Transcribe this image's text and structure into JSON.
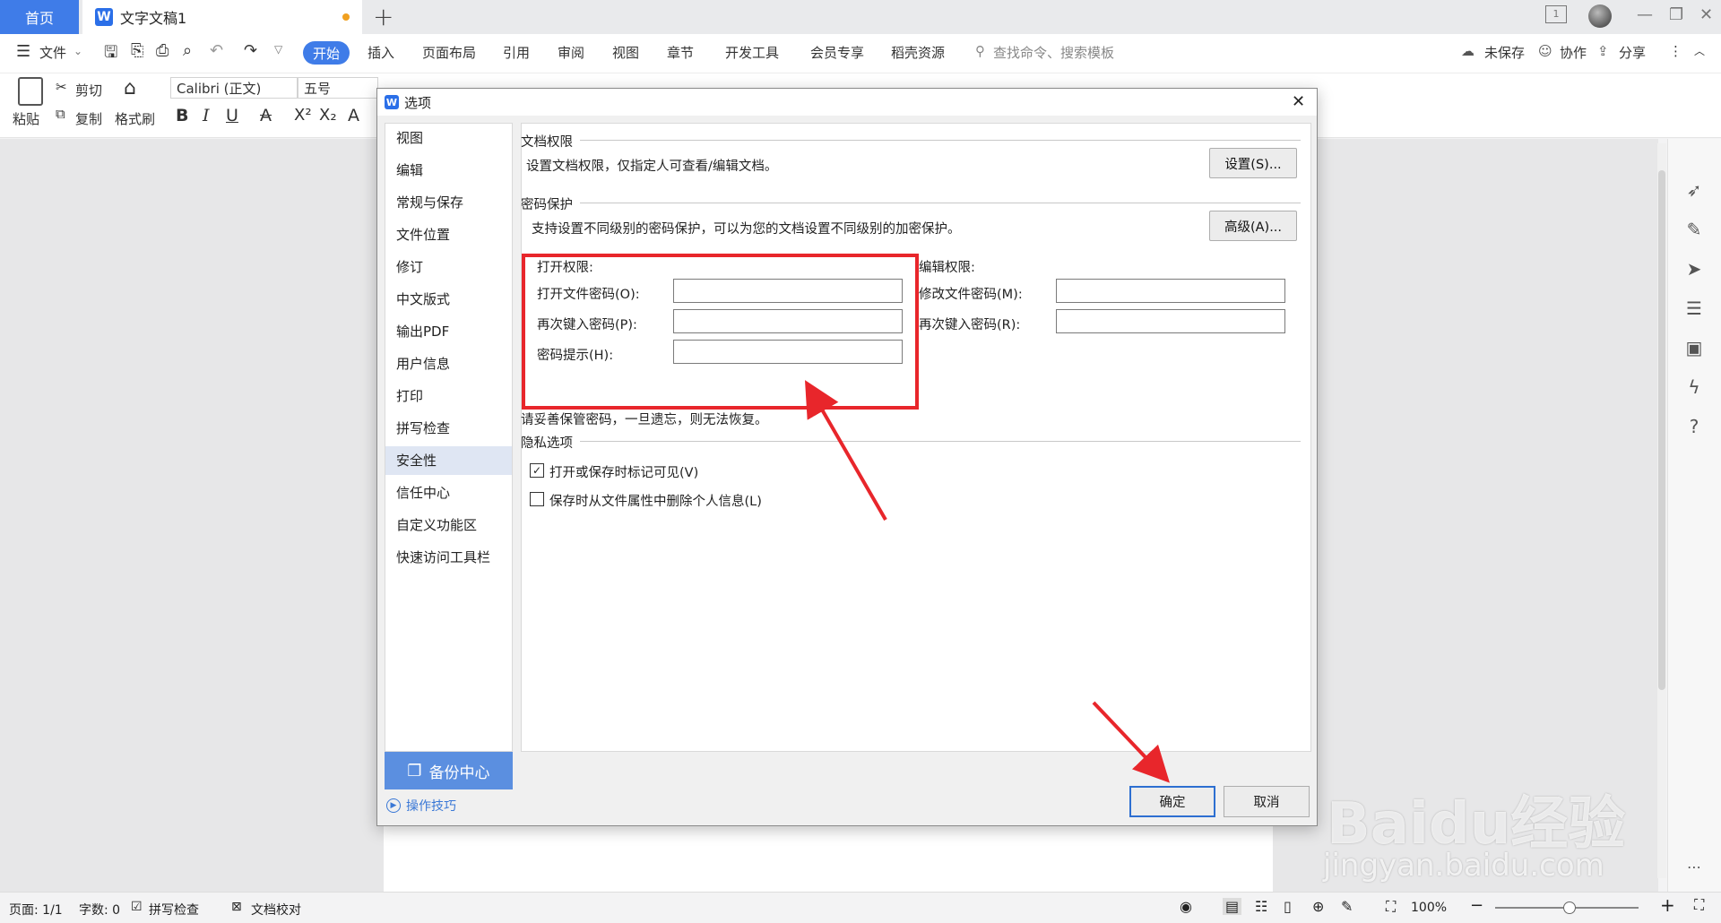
{
  "tabs": {
    "home": "首页",
    "doc": "文字文稿1",
    "new": "+"
  },
  "menu": {
    "file": "文件",
    "start": "开始",
    "items": [
      "插入",
      "页面布局",
      "引用",
      "审阅",
      "视图",
      "章节",
      "开发工具",
      "会员专享",
      "稻壳资源"
    ],
    "search_placeholder": "查找命令、搜索模板",
    "unsaved": "未保存",
    "collab": "协作",
    "share": "分享"
  },
  "ribbon": {
    "paste": "粘贴",
    "cut": "剪切",
    "copy": "复制",
    "format_painter": "格式刷",
    "font": "Calibri (正文)",
    "size": "五号"
  },
  "dialog": {
    "title": "选项",
    "nav": [
      "视图",
      "编辑",
      "常规与保存",
      "文件位置",
      "修订",
      "中文版式",
      "输出PDF",
      "用户信息",
      "打印",
      "拼写检查",
      "安全性",
      "信任中心",
      "自定义功能区",
      "快速访问工具栏"
    ],
    "nav_selected": "安全性",
    "backup": "备份中心",
    "tips": "操作技巧",
    "doc_perm": {
      "title": "文档权限",
      "desc": "设置文档权限，仅指定人可查看/编辑文档。",
      "button": "设置(S)..."
    },
    "pwd_protect": {
      "title": "密码保护",
      "desc": "支持设置不同级别的密码保护，可以为您的文档设置不同级别的加密保护。",
      "button": "高级(A)..."
    },
    "open_perm": {
      "title": "打开权限:",
      "open_pwd": "打开文件密码(O):",
      "reenter": "再次键入密码(P):",
      "hint": "密码提示(H):"
    },
    "edit_perm": {
      "title": "编辑权限:",
      "modify_pwd": "修改文件密码(M):",
      "reenter": "再次键入密码(R):"
    },
    "warning": "请妥善保管密码，一旦遗忘，则无法恢复。",
    "privacy": {
      "title": "隐私选项",
      "opt1": "打开或保存时标记可见(V)",
      "opt1_checked": true,
      "opt2": "保存时从文件属性中删除个人信息(L)",
      "opt2_checked": false
    },
    "ok": "确定",
    "cancel": "取消"
  },
  "status": {
    "page": "页面: 1/1",
    "words": "字数: 0",
    "spell": "拼写检查",
    "proof": "文档校对",
    "zoom": "100%"
  },
  "watermark": {
    "brand": "Baidu经验",
    "url": "jingyan.baidu.com"
  },
  "colors": {
    "accent": "#3f7ce8",
    "highlight_red": "#e8262b"
  }
}
